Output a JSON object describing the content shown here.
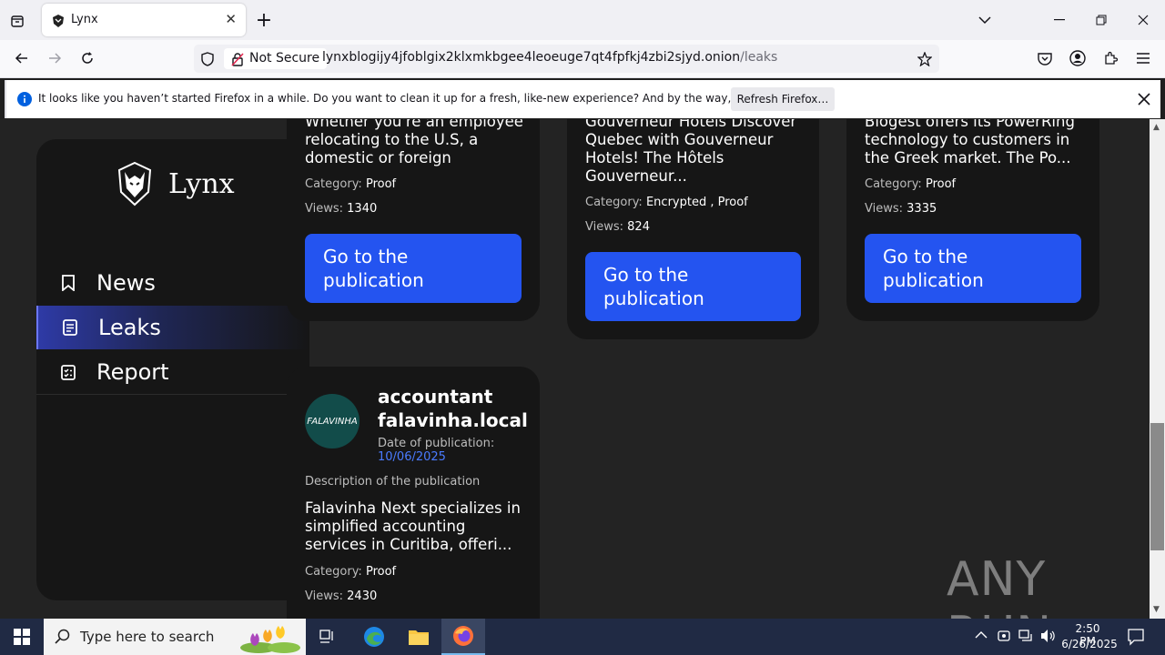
{
  "browser": {
    "tab_title": "Lynx",
    "security_label": "Not Secure",
    "url_host": "lynxblogijy4jfoblgix2klxmkbgee4leoeuge7qt4fpfkj4zbi2sjyd.onion",
    "url_path": "/leaks"
  },
  "notification": {
    "message": "It looks like you haven’t started Firefox in a while. Do you want to clean it up for a fresh, like-new experience? And by the way, welcome back!",
    "button": "Refresh Firefox…"
  },
  "sidebar": {
    "logo_text": "Lynx",
    "items": [
      {
        "label": "News",
        "icon": "bookmark-icon"
      },
      {
        "label": "Leaks",
        "icon": "document-icon",
        "active": true
      },
      {
        "label": "Report",
        "icon": "checklist-icon"
      }
    ]
  },
  "labels": {
    "category": "Category:",
    "views": "Views:",
    "go_button": "Go to the publication",
    "date_label": "Date of publication:",
    "description_label": "Description of the publication"
  },
  "cards": [
    {
      "text": "Whether you're an employee relocating to the U.S, a domestic or foreign investor...",
      "category": "Proof",
      "views": "1340"
    },
    {
      "text": "Gouverneur Hotels Discover Quebec with Gouverneur Hotels! The Hôtels Gouverneur...",
      "category": "Encrypted , Proof",
      "views": "824"
    },
    {
      "text": "Blogest offers its PowerRing technology to customers in the Greek market. The Po...",
      "category": "Proof",
      "views": "3335"
    },
    {
      "title": "accountant falavinha.local",
      "avatar_text": "FALAVINHA",
      "date": "10/06/2025",
      "text": "Falavinha Next specializes in simplified accounting services in Curitiba, offeri...",
      "category": "Proof",
      "views": "2430"
    }
  ],
  "watermark": "ANY RUN",
  "taskbar": {
    "search_placeholder": "Type here to search",
    "time": "2:50 PM",
    "date": "6/26/2025"
  },
  "colors": {
    "accent": "#2454f0",
    "page_bg": "#232323",
    "card_bg": "#161616",
    "date_link": "#4a7bff"
  }
}
